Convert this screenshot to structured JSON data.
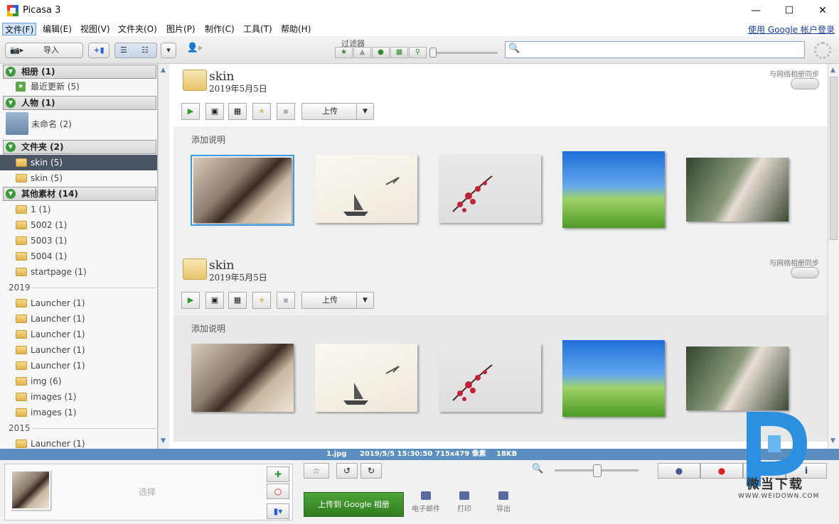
{
  "window": {
    "title": "Picasa 3",
    "minimize": "—",
    "maximize": "☐",
    "close": "✕"
  },
  "menubar": {
    "items": [
      "文件(F)",
      "编辑(E)",
      "视图(V)",
      "文件夹(O)",
      "图片(P)",
      "制作(C)",
      "工具(T)",
      "帮助(H)"
    ],
    "login": "使用 Google 帐户登录"
  },
  "toolbar": {
    "import_label": "导入",
    "filter_label": "过滤器",
    "search_placeholder": ""
  },
  "sidebar": {
    "groups": [
      {
        "label": "相册 (1)"
      },
      {
        "label": "人物 (1)"
      },
      {
        "label": "文件夹 (2)"
      },
      {
        "label": "其他素材 (14)"
      }
    ],
    "albums": [
      {
        "label": "最近更新 (5)"
      }
    ],
    "people": [
      {
        "label": "未命名 (2)"
      }
    ],
    "folders": [
      {
        "label": "skin (5)"
      },
      {
        "label": "skin (5)"
      }
    ],
    "other": [
      {
        "label": "1 (1)"
      },
      {
        "label": "5002 (1)"
      },
      {
        "label": "5003 (1)"
      },
      {
        "label": "5004 (1)"
      },
      {
        "label": "startpage (1)"
      }
    ],
    "year_2019": "2019",
    "items_2019": [
      {
        "label": "Launcher (1)"
      },
      {
        "label": "Launcher (1)"
      },
      {
        "label": "Launcher (1)"
      },
      {
        "label": "Launcher (1)"
      },
      {
        "label": "Launcher (1)"
      },
      {
        "label": "img (6)"
      },
      {
        "label": "images (1)"
      },
      {
        "label": "images (1)"
      }
    ],
    "year_2015": "2015",
    "items_2015": [
      {
        "label": "Launcher (1)"
      }
    ]
  },
  "albums": [
    {
      "name": "skin",
      "date": "2019年5月5日",
      "sync": "与网络相册同步",
      "upload": "上传",
      "caption": "添加说明"
    },
    {
      "name": "skin",
      "date": "2019年5月5日",
      "sync": "与网络相册同步",
      "upload": "上传",
      "caption": "添加说明"
    }
  ],
  "status": {
    "filename": "1.jpg",
    "datetime": "2019/5/5 15:30:50",
    "dimensions": "715x479 像素",
    "size": "18KB"
  },
  "tray": {
    "select_label": "选择",
    "upload_google": "上传到 Google 相册",
    "email": "电子邮件",
    "print": "打印",
    "export": "导出"
  },
  "watermark": {
    "text": "微当下载",
    "url": "WWW.WEIDOWN.COM"
  },
  "colors": {
    "accent": "#3d9be6",
    "status_bar": "#5b8fbf",
    "upload_green": "#3b8f2a",
    "selected_row": "#4b5563"
  }
}
